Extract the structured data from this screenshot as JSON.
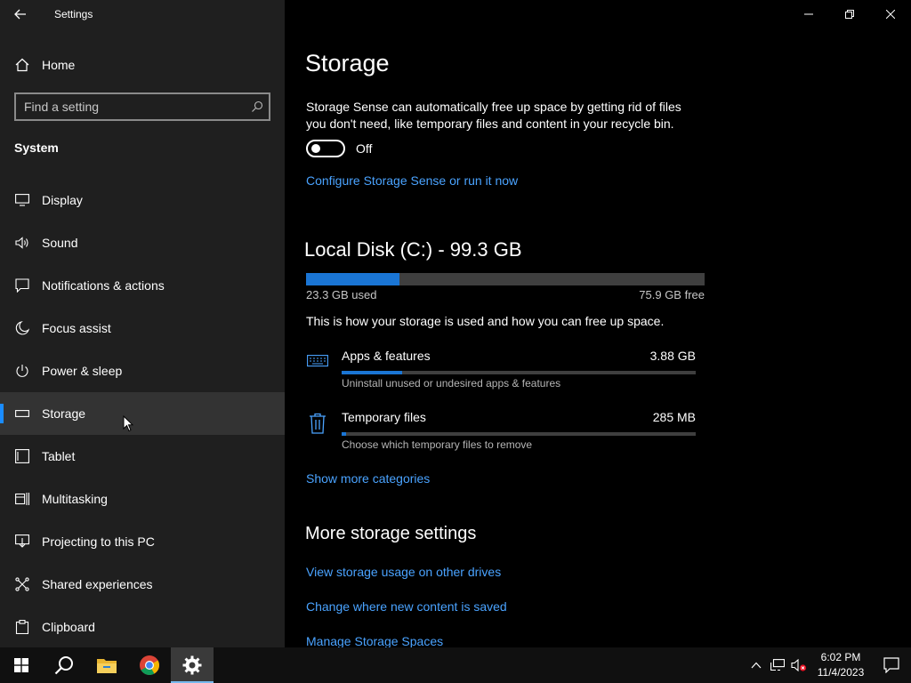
{
  "window": {
    "title": "Settings"
  },
  "sidebar": {
    "home_label": "Home",
    "search_placeholder": "Find a setting",
    "section_label": "System",
    "items": [
      {
        "label": "Display",
        "icon": "monitor-icon"
      },
      {
        "label": "Sound",
        "icon": "speaker-icon"
      },
      {
        "label": "Notifications & actions",
        "icon": "notification-icon"
      },
      {
        "label": "Focus assist",
        "icon": "moon-icon"
      },
      {
        "label": "Power & sleep",
        "icon": "power-icon"
      },
      {
        "label": "Storage",
        "icon": "storage-drive-icon",
        "selected": true
      },
      {
        "label": "Tablet",
        "icon": "tablet-icon"
      },
      {
        "label": "Multitasking",
        "icon": "multitasking-icon"
      },
      {
        "label": "Projecting to this PC",
        "icon": "projecting-icon"
      },
      {
        "label": "Shared experiences",
        "icon": "shared-experiences-icon"
      },
      {
        "label": "Clipboard",
        "icon": "clipboard-icon"
      }
    ]
  },
  "main": {
    "title": "Storage",
    "description": "Storage Sense can automatically free up space by getting rid of files you don't need, like temporary files and content in your recycle bin.",
    "toggle_state": "Off",
    "configure_link": "Configure Storage Sense or run it now",
    "disk": {
      "title": "Local Disk (C:) - 99.3 GB",
      "used_label": "23.3 GB used",
      "free_label": "75.9 GB free",
      "used_fraction": 0.235,
      "note": "This is how your storage is used and how you can free up space."
    },
    "categories": [
      {
        "name": "Apps & features",
        "size": "3.88 GB",
        "sub": "Uninstall unused or undesired apps & features",
        "fraction": 0.17,
        "icon": "keyboard-icon"
      },
      {
        "name": "Temporary files",
        "size": "285 MB",
        "sub": "Choose which temporary files to remove",
        "fraction": 0.012,
        "icon": "trash-icon"
      }
    ],
    "show_more_link": "Show more categories",
    "more_title": "More storage settings",
    "more_links": [
      "View storage usage on other drives",
      "Change where new content is saved",
      "Manage Storage Spaces"
    ]
  },
  "taskbar": {
    "time": "6:02 PM",
    "date": "11/4/2023"
  },
  "colors": {
    "accent": "#1a8cff",
    "link": "#4aa3ff",
    "bar_fill": "#1a75d4"
  }
}
